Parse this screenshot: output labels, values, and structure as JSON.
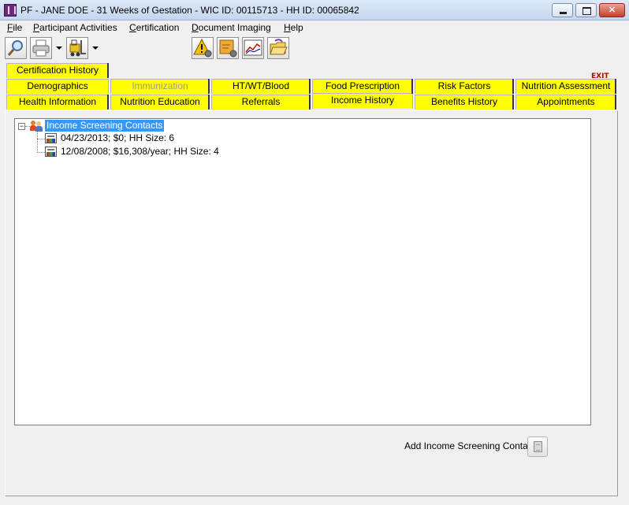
{
  "window": {
    "title": "PF - JANE DOE - 31 Weeks of Gestation - WIC ID: 00115713 - HH ID: 00065842",
    "controls": [
      "minimize",
      "maximize",
      "close"
    ]
  },
  "menu": [
    {
      "label": "File",
      "accel": "F",
      "rest": "ile"
    },
    {
      "label": "Participant Activities",
      "accel": "P",
      "rest": "articipant Activities"
    },
    {
      "label": "Certification",
      "accel": "C",
      "rest": "ertification"
    },
    {
      "label": "Document Imaging",
      "accel": "D",
      "rest": "ocument Imaging"
    },
    {
      "label": "Help",
      "accel": "H",
      "rest": "elp"
    }
  ],
  "toolbar": {
    "icons": [
      "search-icon",
      "printer-icon",
      "forklift-icon",
      "alert-settings-icon",
      "notes-settings-icon",
      "growth-chart-icon",
      "open-folder-icon",
      "exit-icon"
    ],
    "exit_label": "EXIT"
  },
  "tabs": {
    "row0": [
      {
        "label": "Certification History"
      }
    ],
    "row1": [
      {
        "label": "Demographics"
      },
      {
        "label": "Immunization",
        "disabled": true
      },
      {
        "label": "HT/WT/Blood"
      },
      {
        "label": "Food Prescription"
      },
      {
        "label": "Risk Factors"
      },
      {
        "label": "Nutrition Assessment"
      }
    ],
    "row2": [
      {
        "label": "Health Information"
      },
      {
        "label": "Nutrition Education"
      },
      {
        "label": "Referrals"
      },
      {
        "label": "Income History",
        "selected": true
      },
      {
        "label": "Benefits History"
      },
      {
        "label": "Appointments"
      }
    ]
  },
  "tree": {
    "expander": "−",
    "root": "Income Screening Contacts",
    "children": [
      "04/23/2013; $0; HH Size: 6",
      "12/08/2008; $16,308/year; HH Size: 4"
    ]
  },
  "actions": {
    "add_contact_label": "Add Income Screening Contact"
  },
  "colors": {
    "tab_yellow": "#ffff00",
    "selection_blue": "#3399ff",
    "title_gradient_top": "#dde9f7",
    "panel_bg": "#f0f0f0"
  }
}
